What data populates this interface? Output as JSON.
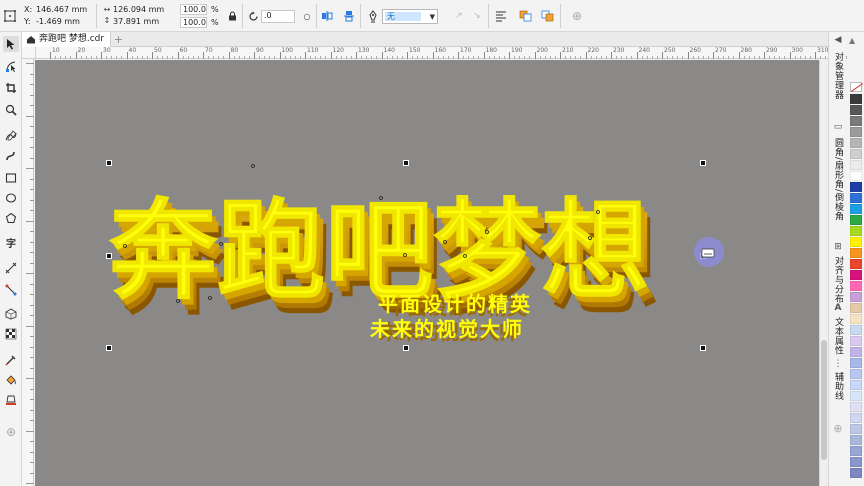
{
  "propbar": {
    "x_label": "X:",
    "x_value": "146.467 mm",
    "y_label": "Y:",
    "y_value": "-1.469 mm",
    "w_value": "126.094 mm",
    "h_value": "37.891 mm",
    "scale_w": "100.0",
    "scale_h": "100.0",
    "scale_unit": "%",
    "rotation": ".0",
    "outline_select": "无"
  },
  "tabs": [
    {
      "label": "奔跑吧 梦想.cdr"
    }
  ],
  "ruler_h": [
    "10",
    "20",
    "30",
    "40",
    "50",
    "60",
    "70",
    "80",
    "90",
    "100",
    "110",
    "120",
    "130",
    "140",
    "150",
    "160",
    "170",
    "180",
    "190",
    "200",
    "210",
    "220",
    "230",
    "240",
    "250",
    "260",
    "270",
    "280",
    "290",
    "300",
    "310"
  ],
  "dockers": {
    "obj_manager": "对象管理器",
    "corner": "圆角/扇形角/倒棱角",
    "align": "对齐与分布",
    "text_props": "文本属性",
    "guides": "辅助线"
  },
  "artwork": {
    "title_text": "奔跑吧梦想",
    "sub_line1": "平面设计的精英",
    "sub_line2": "未来的视觉大师",
    "fill_color": "#ffff0a",
    "extrude_color": "#d2a200",
    "shadow_color": "#a06800"
  },
  "palette": {
    "colors": [
      "#3a3a3a",
      "#575757",
      "#7a7a7a",
      "#9a9a9a",
      "#b5b5b5",
      "#cfcfcf",
      "#ececec",
      "#ffffff",
      "#1f3fa8",
      "#2f6fd8",
      "#1aa0e0",
      "#2aa845",
      "#a8d820",
      "#fff200",
      "#f7941d",
      "#e8452c",
      "#d9127b",
      "#ff66b3",
      "#c7a0d8",
      "#e5c9a8",
      "#f5e2c0",
      "#c9d9f0",
      "#d9c9f0",
      "#bfb3e8",
      "#a7b7e8",
      "#b7c7f0",
      "#c7d7f8",
      "#d7e7fa",
      "#e0e0f5",
      "#cfd8f0",
      "#bdc7e6",
      "#a8b8dd",
      "#98a6d6",
      "#8897cc",
      "#7c88c3"
    ]
  }
}
